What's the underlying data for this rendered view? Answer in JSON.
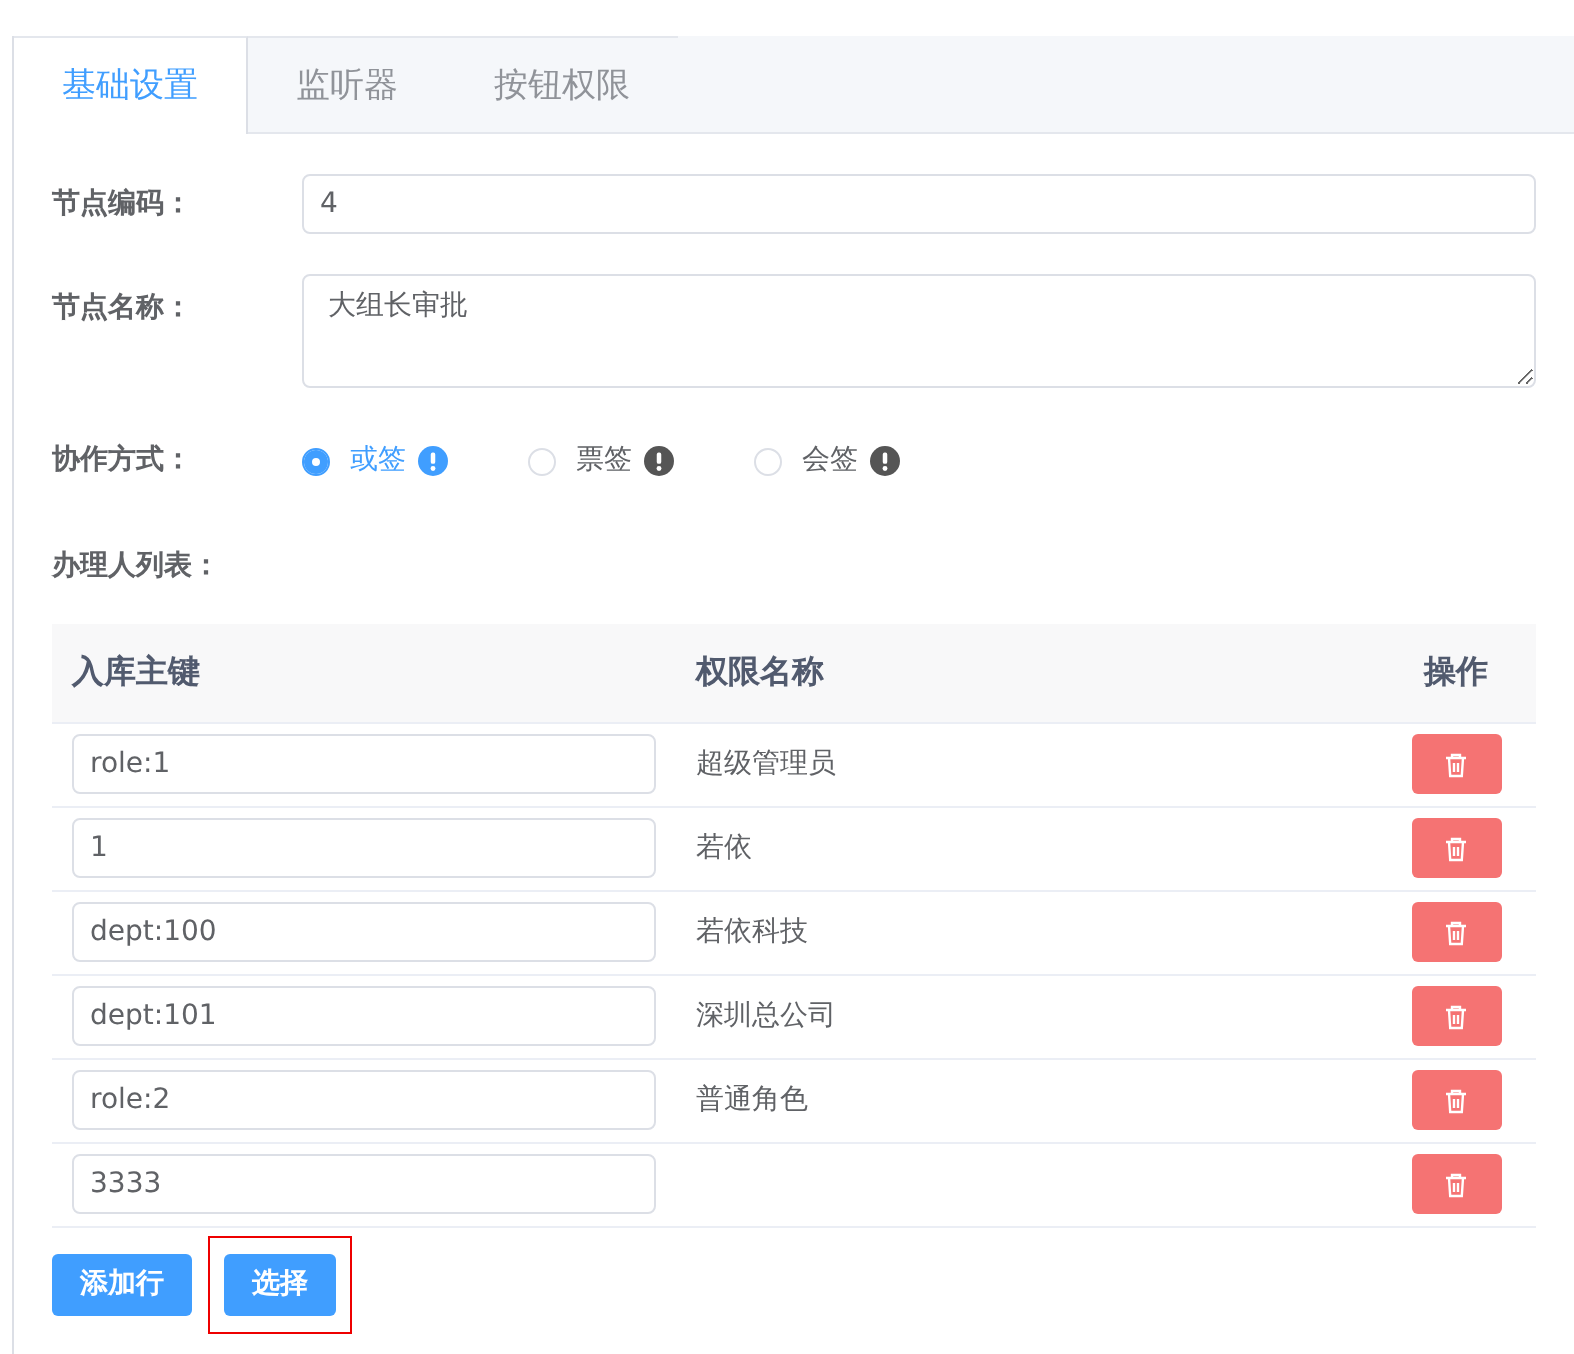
{
  "tabs": [
    {
      "label": "基础设置",
      "selected": true
    },
    {
      "label": "监听器",
      "selected": false
    },
    {
      "label": "按钮权限",
      "selected": false
    }
  ],
  "fields": [
    {
      "label": "节点编码：",
      "kind": "input",
      "value": "4"
    },
    {
      "label": "节点名称：",
      "kind": "textarea",
      "value": "大组长审批"
    }
  ],
  "collaboration": {
    "label": "协作方式：",
    "options": [
      {
        "label": "或签",
        "selected": true
      },
      {
        "label": "票签",
        "selected": false
      },
      {
        "label": "会签",
        "selected": false
      }
    ]
  },
  "handlers": {
    "label": "办理人列表：",
    "columns": [
      "入库主键",
      "权限名称",
      "操作"
    ],
    "rows": [
      {
        "key": "role:1",
        "name": "超级管理员"
      },
      {
        "key": "1",
        "name": "若依"
      },
      {
        "key": "dept:100",
        "name": "若依科技"
      },
      {
        "key": "dept:101",
        "name": "深圳总公司"
      },
      {
        "key": "role:2",
        "name": "普通角色"
      },
      {
        "key": "3333"
      }
    ]
  },
  "buttons": [
    {
      "label": "添加行",
      "highlighted": false
    },
    {
      "label": "选择",
      "highlighted": true
    }
  ]
}
